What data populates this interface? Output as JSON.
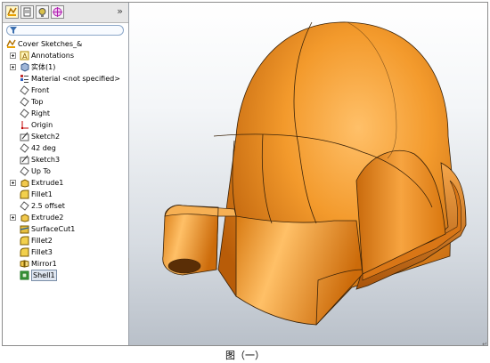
{
  "panel": {
    "tabs": [
      "feature-manager-icon",
      "property-manager-icon",
      "configuration-manager-icon",
      "dim-xpert-icon"
    ],
    "overflow": "»",
    "tree": [
      {
        "label": "Cover Sketches_&",
        "icon": "part-icon",
        "expand": false
      },
      {
        "label": "Annotations",
        "icon": "annotations-icon",
        "expand": true
      },
      {
        "label": "实体(1)",
        "icon": "solid-bodies-icon",
        "expand": true
      },
      {
        "label": "Material <not specified>",
        "icon": "material-icon",
        "expand": false
      },
      {
        "label": "Front",
        "icon": "plane-icon",
        "expand": false
      },
      {
        "label": "Top",
        "icon": "plane-icon",
        "expand": false
      },
      {
        "label": "Right",
        "icon": "plane-icon",
        "expand": false
      },
      {
        "label": "Origin",
        "icon": "origin-icon",
        "expand": false
      },
      {
        "label": "Sketch2",
        "icon": "sketch-icon",
        "expand": false
      },
      {
        "label": "42 deg",
        "icon": "plane-icon",
        "expand": false
      },
      {
        "label": "Sketch3",
        "icon": "sketch-icon",
        "expand": false
      },
      {
        "label": "Up To",
        "icon": "plane-icon",
        "expand": false
      },
      {
        "label": "Extrude1",
        "icon": "extrude-icon",
        "expand": true
      },
      {
        "label": "Fillet1",
        "icon": "fillet-icon",
        "expand": false
      },
      {
        "label": "2.5 offset",
        "icon": "plane-icon",
        "expand": false
      },
      {
        "label": "Extrude2",
        "icon": "extrude-icon",
        "expand": true
      },
      {
        "label": "SurfaceCut1",
        "icon": "surface-cut-icon",
        "expand": false
      },
      {
        "label": "Fillet2",
        "icon": "fillet-icon",
        "expand": false
      },
      {
        "label": "Fillet3",
        "icon": "fillet-icon",
        "expand": false
      },
      {
        "label": "Mirror1",
        "icon": "mirror-icon",
        "expand": false
      },
      {
        "label": "Shell1",
        "icon": "shell-icon",
        "expand": false,
        "selected": true
      }
    ]
  },
  "model": {
    "color": "#e8851a",
    "edge_color": "#3a2208"
  },
  "caption": {
    "text": "图（一）",
    "mark": "↵"
  }
}
